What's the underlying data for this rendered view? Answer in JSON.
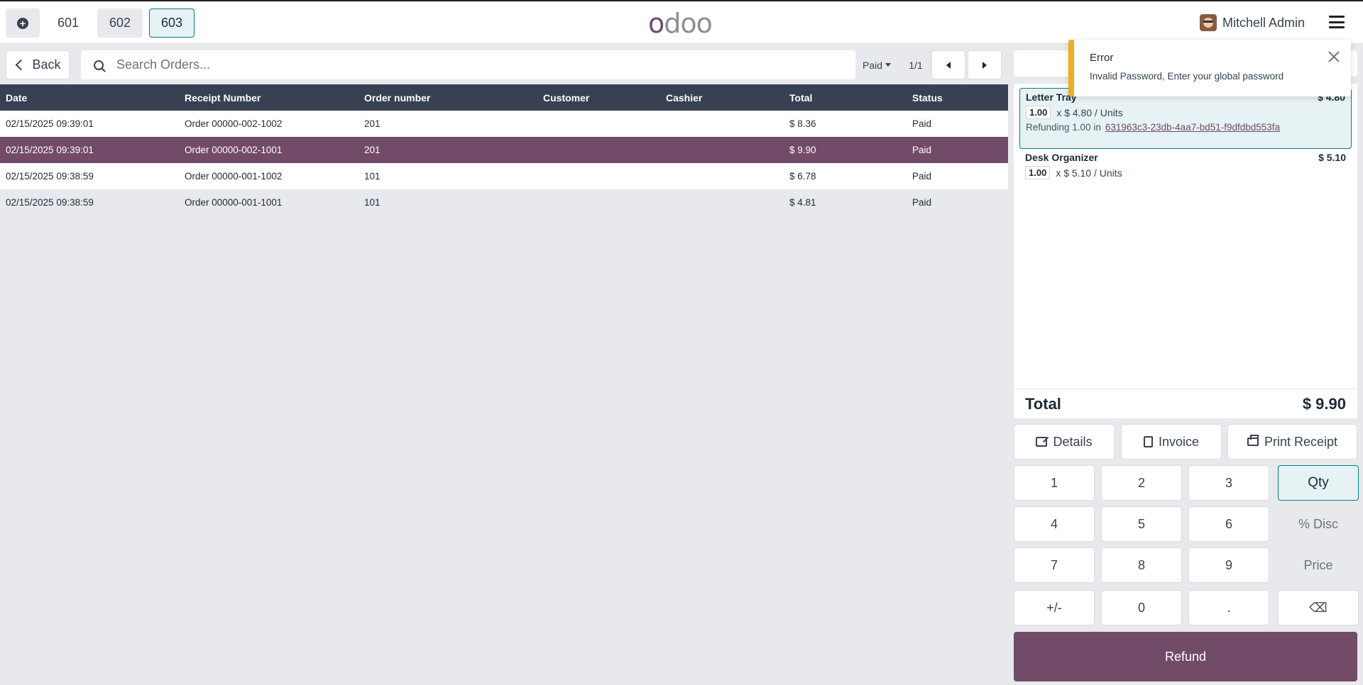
{
  "header": {
    "order_tabs": [
      "601",
      "602",
      "603"
    ],
    "active_tab": "603",
    "logo": {
      "first": "o",
      "rest": "doo"
    },
    "user_name": "Mitchell Admin"
  },
  "toolbar": {
    "back_label": "Back",
    "search_placeholder": "Search Orders...",
    "filter_label": "Paid",
    "pager": "1/1"
  },
  "table": {
    "columns": [
      "Date",
      "Receipt Number",
      "Order number",
      "Customer",
      "Cashier",
      "Total",
      "Status"
    ],
    "rows": [
      {
        "date": "02/15/2025 09:39:01",
        "receipt": "Order 00000-002-1002",
        "order": "201",
        "customer": "",
        "cashier": "",
        "total": "$ 8.36",
        "status": "Paid"
      },
      {
        "date": "02/15/2025 09:39:01",
        "receipt": "Order 00000-002-1001",
        "order": "201",
        "customer": "",
        "cashier": "",
        "total": "$ 9.90",
        "status": "Paid"
      },
      {
        "date": "02/15/2025 09:38:59",
        "receipt": "Order 00000-001-1002",
        "order": "101",
        "customer": "",
        "cashier": "",
        "total": "$ 6.78",
        "status": "Paid"
      },
      {
        "date": "02/15/2025 09:38:59",
        "receipt": "Order 00000-001-1001",
        "order": "101",
        "customer": "",
        "cashier": "",
        "total": "$ 4.81",
        "status": "Paid"
      }
    ],
    "selected_index": 1
  },
  "order_lines": [
    {
      "name": "Letter Tray",
      "price": "$ 4.80",
      "qty": "1.00",
      "unit_text": "x $ 4.80 / Units",
      "refund_text": "Refunding 1.00 in",
      "refund_link": "631963c3-23db-4aa7-bd51-f9dfdbd553fa"
    },
    {
      "name": "Desk Organizer",
      "price": "$ 5.10",
      "qty": "1.00",
      "unit_text": "x $ 5.10 / Units"
    }
  ],
  "totals": {
    "label": "Total",
    "value": "$ 9.90"
  },
  "actions": {
    "details": "Details",
    "invoice": "Invoice",
    "print": "Print Receipt"
  },
  "numpad": {
    "keys": [
      "1",
      "2",
      "3",
      "Qty",
      "4",
      "5",
      "6",
      "% Disc",
      "7",
      "8",
      "9",
      "Price",
      "+/-",
      "0",
      ".",
      "⌫"
    ],
    "active_mode": "Qty"
  },
  "refund_label": "Refund",
  "toast": {
    "title": "Error",
    "message": "Invalid Password, Enter your global password"
  },
  "colors": {
    "brand": "#714b67",
    "accent": "#017e84",
    "warning": "#f0ad1c",
    "header_dark": "#374151"
  }
}
